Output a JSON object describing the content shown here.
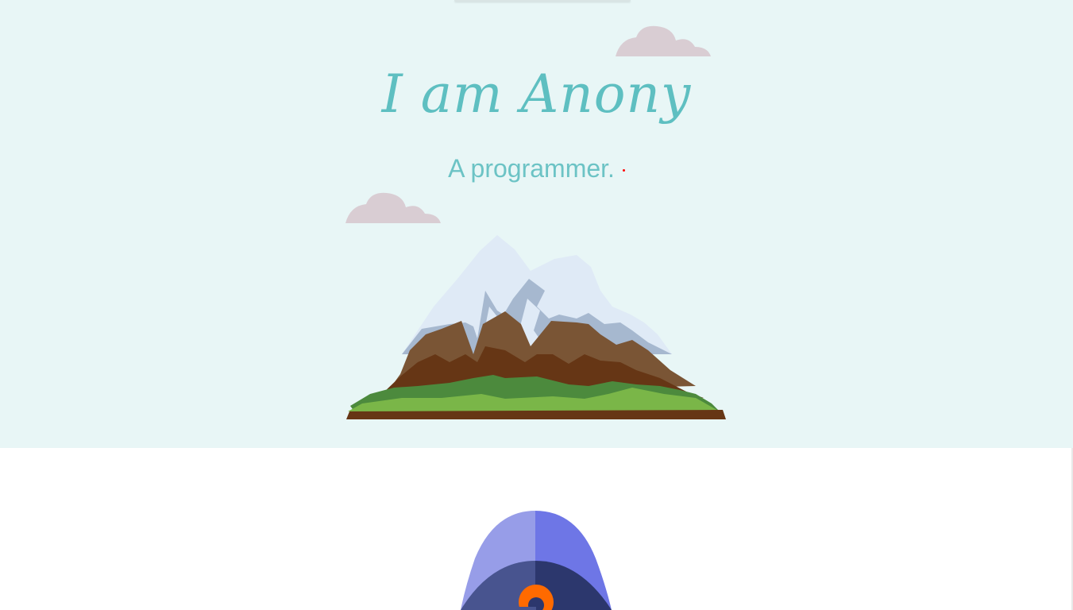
{
  "hero": {
    "title": "I am Anony",
    "subtitle": "A programmer.",
    "background": "#e8f6f6",
    "title_color": "#5ebfc1",
    "subtitle_color": "#6cc3c5",
    "cursor_color": "#ff0000"
  },
  "illustrations": {
    "clouds": [
      "cloud-icon",
      "cloud-icon"
    ],
    "mountain": "mountain-illustration",
    "rocket": "rocket-illustration"
  },
  "colors": {
    "cloud": "#d9cdd3",
    "snow": "#dfeaf6",
    "snow_shadow": "#a6b8cf",
    "rock_light": "#7a5535",
    "rock_dark": "#663615",
    "grass_dark": "#4c8a3d",
    "grass_light": "#7ab648",
    "rocket_light": "#979de8",
    "rocket_mid": "#6e76e6",
    "rocket_dark": "#48548f",
    "rocket_darker": "#2c376d",
    "rocket_window": "#ff6a00"
  }
}
